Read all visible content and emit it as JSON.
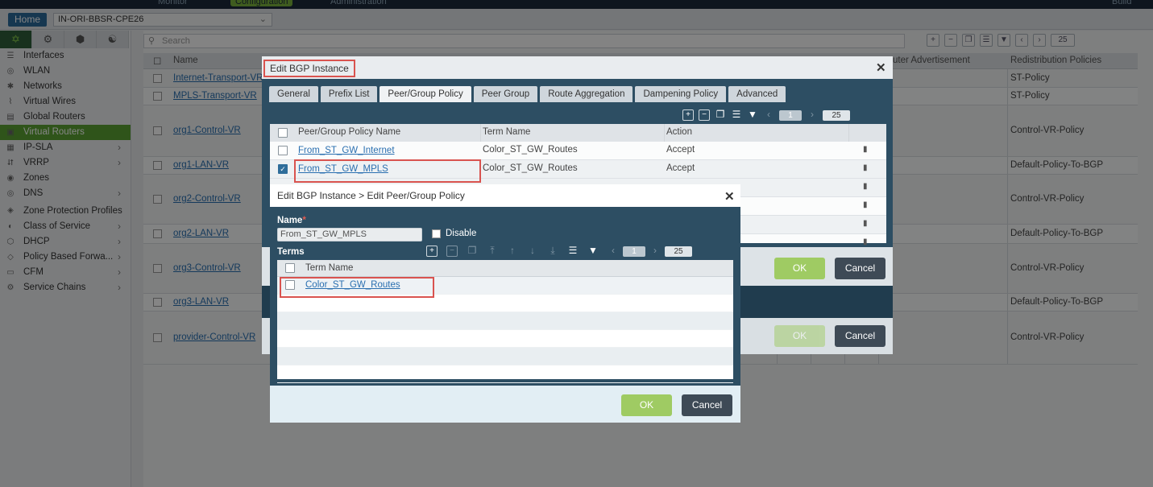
{
  "topnav": {
    "monitor": "Monitor",
    "configuration": "Configuration",
    "administration": "Administration",
    "right": "Build"
  },
  "appbar": {
    "home": "Home",
    "device": "IN-ORI-BBSR-CPE26"
  },
  "sidebar": {
    "items": [
      {
        "label": "Interfaces",
        "icon": "interfaces-icon",
        "chevron": false
      },
      {
        "label": "WLAN",
        "icon": "wlan-icon",
        "chevron": false
      },
      {
        "label": "Networks",
        "icon": "networks-icon",
        "chevron": false
      },
      {
        "label": "Virtual Wires",
        "icon": "virtual-wires-icon",
        "chevron": false
      },
      {
        "label": "Global Routers",
        "icon": "global-routers-icon",
        "chevron": false
      },
      {
        "label": "Virtual Routers",
        "icon": "virtual-routers-icon",
        "chevron": false,
        "active": true
      },
      {
        "label": "IP-SLA",
        "icon": "ip-sla-icon",
        "chevron": true
      },
      {
        "label": "VRRP",
        "icon": "vrrp-icon",
        "chevron": true
      },
      {
        "label": "Zones",
        "icon": "zones-icon",
        "chevron": false
      },
      {
        "label": "DNS",
        "icon": "dns-icon",
        "chevron": true
      },
      {
        "label": "Zone Protection Profiles",
        "icon": "zone-protection-icon",
        "chevron": false
      },
      {
        "label": "Class of Service",
        "icon": "class-of-service-icon",
        "chevron": true
      },
      {
        "label": "DHCP",
        "icon": "dhcp-icon",
        "chevron": true
      },
      {
        "label": "Policy Based Forwa...",
        "icon": "pbf-icon",
        "chevron": true
      },
      {
        "label": "CFM",
        "icon": "cfm-icon",
        "chevron": true
      },
      {
        "label": "Service Chains",
        "icon": "service-chains-icon",
        "chevron": true
      }
    ]
  },
  "main": {
    "search_placeholder": "Search",
    "page_size": "25",
    "columns": {
      "name": "Name",
      "router_adv": "uter Advertisement",
      "redistribution": "Redistribution Policies"
    },
    "rows": [
      {
        "name": "Internet-Transport-VR",
        "policy": "ST-Policy"
      },
      {
        "name": "MPLS-Transport-VR",
        "policy": "ST-Policy"
      },
      {
        "name": "org1-Control-VR",
        "policy": "Control-VR-Policy"
      },
      {
        "name": "org1-LAN-VR",
        "policy": "Default-Policy-To-BGP"
      },
      {
        "name": "org2-Control-VR",
        "policy": "Control-VR-Policy"
      },
      {
        "name": "org2-LAN-VR",
        "policy": "Default-Policy-To-BGP"
      },
      {
        "name": "org3-Control-VR",
        "policy": "Control-VR-Policy"
      },
      {
        "name": "org3-LAN-VR",
        "policy": "Default-Policy-To-BGP"
      },
      {
        "name": "provider-Control-VR",
        "policy": "Control-VR-Policy"
      }
    ]
  },
  "dialog_bgp": {
    "title": "Edit BGP Instance",
    "tabs": [
      "General",
      "Prefix List",
      "Peer/Group Policy",
      "Peer Group",
      "Route Aggregation",
      "Dampening Policy",
      "Advanced"
    ],
    "active_tab": "Peer/Group Policy",
    "page": "1",
    "page_size": "25",
    "columns": {
      "policy_name": "Peer/Group Policy Name",
      "term_name": "Term Name",
      "action": "Action"
    },
    "rows": [
      {
        "name": "From_ST_GW_Internet",
        "term": "Color_ST_GW_Routes",
        "action": "Accept",
        "checked": false
      },
      {
        "name": "From_ST_GW_MPLS",
        "term": "Color_ST_GW_Routes",
        "action": "Accept",
        "checked": true
      }
    ],
    "ok": "OK",
    "cancel": "Cancel"
  },
  "dialog_policy": {
    "title": "Edit BGP Instance > Edit Peer/Group Policy",
    "name_label": "Name",
    "required_mark": "*",
    "name_value": "From_ST_GW_MPLS",
    "disable_label": "Disable",
    "terms_label": "Terms",
    "page": "1",
    "page_size": "25",
    "column_term": "Term Name",
    "rows": [
      {
        "term": "Color_ST_GW_Routes"
      }
    ],
    "ok": "OK",
    "cancel": "Cancel"
  },
  "colors": {
    "accent": "#5aa232",
    "dialog_bg": "#2d4e63",
    "ok_button": "#9fcb63",
    "highlight_box": "#d9534f",
    "link": "#2a6fb0"
  }
}
